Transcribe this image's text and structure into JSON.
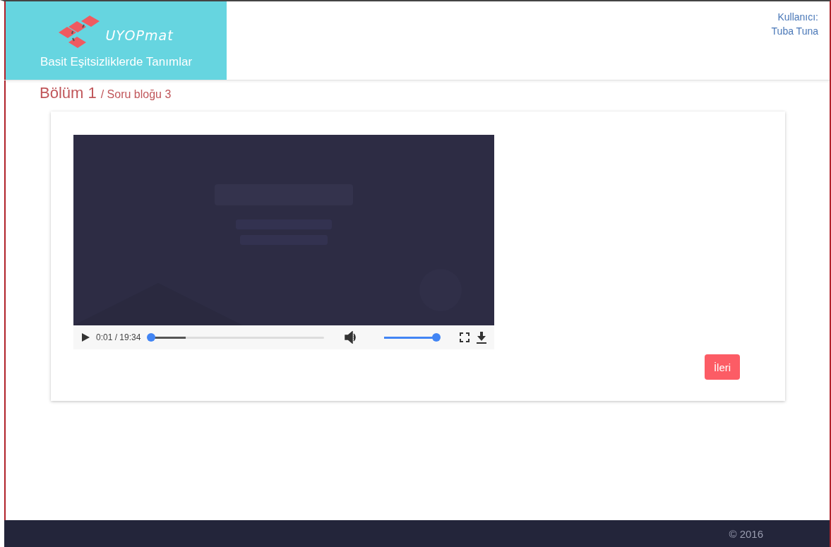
{
  "header": {
    "logo_text": "UYOPmat",
    "course_title": "Basit Eşitsizliklerde Tanımlar",
    "user_label": "Kullanıcı:",
    "user_name": "Tuba Tuna"
  },
  "breadcrumb": {
    "section": "Bölüm 1",
    "block": "/ Soru bloğu 3"
  },
  "video": {
    "kind": "picture",
    "time": "0:01 / 19:34",
    "progress": {
      "level": 0.001
    },
    "volume": {
      "level": 1
    }
  },
  "next_button": "İleri",
  "footer": {
    "copyright": "© 2016"
  }
}
